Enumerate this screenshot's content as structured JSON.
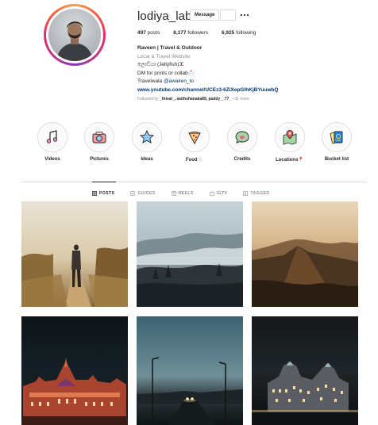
{
  "profile": {
    "username": "lodiya_labs",
    "message_label": "Message",
    "stats": [
      {
        "count": "497",
        "label": "posts"
      },
      {
        "count": "8,177",
        "label": "followers"
      },
      {
        "count": "6,925",
        "label": "following"
      }
    ],
    "bio": {
      "full_name": "Raveen | Travel & Outdoor",
      "category": "Local & Travel Website",
      "line1": "ලොඩියා (Jellyfish)ⵋ",
      "line2": "DM for prints or collab📩",
      "line3_text": "Travelwala ",
      "line3_mention": "@awaken_to",
      "link": "www.youtube.com/channel/UCEz3-6ZiXepGlhKjBYuuwbQ",
      "followed_prefix": "Followed by ",
      "followed_users": "_thisal_, asithshanaka89, paddy__77_",
      "followed_more": " +31 more"
    }
  },
  "highlights": [
    {
      "label": "Videos",
      "icon": "music-note-icon"
    },
    {
      "label": "Pictures",
      "icon": "camera-icon"
    },
    {
      "label": "Ideas",
      "icon": "star-icon"
    },
    {
      "label": "Food🍴",
      "icon": "pizza-icon"
    },
    {
      "label": "Credits",
      "icon": "heart-chat-icon"
    },
    {
      "label": "Locations📍",
      "icon": "map-pin-icon"
    },
    {
      "label": "Bucket list",
      "icon": "passport-icon"
    }
  ],
  "tabs": [
    {
      "label": "POSTS",
      "icon": "grid-icon",
      "active": true
    },
    {
      "label": "GUIDES",
      "icon": "guide-icon",
      "active": false
    },
    {
      "label": "REELS",
      "icon": "reels-icon",
      "active": false
    },
    {
      "label": "IGTV",
      "icon": "igtv-icon",
      "active": false
    },
    {
      "label": "TAGGED",
      "icon": "tag-icon",
      "active": false
    }
  ],
  "posts": [
    {
      "scene": "person-walking-path"
    },
    {
      "scene": "misty-mountains"
    },
    {
      "scene": "mountain-ridge-sunset"
    },
    {
      "scene": "night-railway-station"
    },
    {
      "scene": "night-road-streetlights"
    },
    {
      "scene": "night-hotel-building"
    }
  ],
  "colors": {
    "text": "#262626",
    "muted": "#8e8e8e",
    "link": "#00376b",
    "border": "#dbdbdb"
  }
}
